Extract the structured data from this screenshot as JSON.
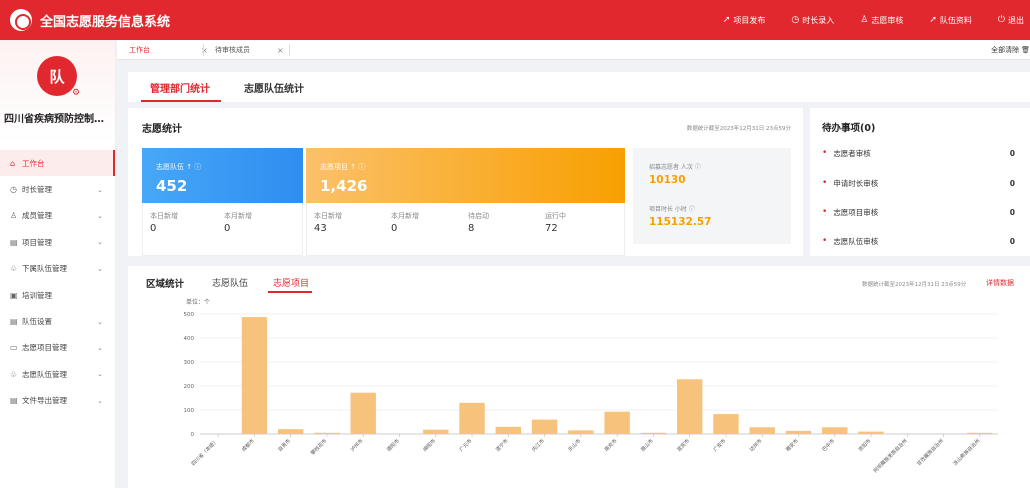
{
  "app": {
    "title": "全国志愿服务信息系统"
  },
  "top_nav": [
    {
      "icon": "send-icon",
      "glyph": "➚",
      "label": "项目发布"
    },
    {
      "icon": "clock-icon",
      "glyph": "◷",
      "label": "时长录入"
    },
    {
      "icon": "user-check-icon",
      "glyph": "♙",
      "label": "志愿审核"
    },
    {
      "icon": "send-icon",
      "glyph": "➚",
      "label": "队伍资料"
    },
    {
      "icon": "logout-icon",
      "glyph": "⏻",
      "label": "退出"
    }
  ],
  "sidebar": {
    "avatar_text": "队",
    "org_name": "四川省疾病预防控制…",
    "items": [
      {
        "icon": "home-icon",
        "glyph": "⌂",
        "label": "工作台",
        "active": true
      },
      {
        "icon": "clock-icon",
        "glyph": "◷",
        "label": "时长管理",
        "expandable": true
      },
      {
        "icon": "user-icon",
        "glyph": "♙",
        "label": "成员管理",
        "expandable": true
      },
      {
        "icon": "calendar-icon",
        "glyph": "▤",
        "label": "项目管理",
        "expandable": true
      },
      {
        "icon": "team-icon",
        "glyph": "♧",
        "label": "下属队伍管理",
        "expandable": true
      },
      {
        "icon": "training-icon",
        "glyph": "▣",
        "label": "培训管理"
      },
      {
        "icon": "settings-icon",
        "glyph": "▤",
        "label": "队伍设置",
        "expandable": true
      },
      {
        "icon": "monitor-icon",
        "glyph": "▭",
        "label": "志愿项目管理",
        "expandable": true
      },
      {
        "icon": "team-manage-icon",
        "glyph": "♧",
        "label": "志愿队伍管理",
        "expandable": true
      },
      {
        "icon": "export-icon",
        "glyph": "▤",
        "label": "文件导出管理",
        "expandable": true
      }
    ]
  },
  "tabs": {
    "workbench": "工作台",
    "pending_members": "待审核成员",
    "close_glyph": "×",
    "clear_all": "全部清除"
  },
  "subtabs": {
    "dept": "管理部门统计",
    "team": "志愿队伍统计"
  },
  "stats": {
    "title": "志愿统计",
    "updated": "数据统计截至2023年12月31日 23点59分",
    "team_card": {
      "label": "志愿队伍 ↑ ⓘ",
      "value": "452",
      "today_label": "本日新增",
      "today": "0",
      "month_label": "本月新增",
      "month": "0"
    },
    "project_card": {
      "label": "志愿项目 ↑ ⓘ",
      "value": "1,426",
      "today_label": "本日新增",
      "today": "43",
      "month_label": "本月新增",
      "month": "0",
      "pending_label": "待启动",
      "pending": "8",
      "running_label": "运行中",
      "running": "72"
    },
    "recruit": {
      "label": "招募志愿者  人次 ⓘ",
      "value": "10130"
    },
    "hours": {
      "label": "项目时长  小时 ⓘ",
      "value": "115132.57"
    }
  },
  "todo": {
    "title": "待办事项(0)",
    "items": [
      {
        "label": "志愿者审核",
        "count": "0"
      },
      {
        "label": "申请时长审核",
        "count": "0"
      },
      {
        "label": "志愿项目审核",
        "count": "0"
      },
      {
        "label": "志愿队伍审核",
        "count": "0"
      }
    ]
  },
  "region": {
    "title": "区域统计",
    "tab_team": "志愿队伍",
    "tab_project": "志愿项目",
    "updated": "数据统计截至2023年12月31日 23点59分",
    "detail_link": "详情数据"
  },
  "colors": {
    "brand": "#e0282e",
    "blue": "#3a9bf5",
    "orange": "#f8a000",
    "bar": "#f7c27c"
  },
  "chart_data": {
    "type": "bar",
    "unit": "单位：个",
    "ylim": [
      0,
      500
    ],
    "yticks": [
      0,
      100,
      200,
      300,
      400,
      500
    ],
    "categories": [
      "四川省（本级）",
      "成都市",
      "自贡市",
      "攀枝花市",
      "泸州市",
      "德阳市",
      "绵阳市",
      "广元市",
      "遂宁市",
      "内江市",
      "乐山市",
      "南充市",
      "眉山市",
      "宜宾市",
      "广安市",
      "达州市",
      "雅安市",
      "巴中市",
      "资阳市",
      "阿坝藏族羌族自治州",
      "甘孜藏族自治州",
      "凉山彝族自治州"
    ],
    "values": [
      0,
      487,
      20,
      5,
      172,
      0,
      18,
      130,
      30,
      60,
      15,
      93,
      5,
      228,
      83,
      28,
      13,
      28,
      10,
      0,
      0,
      5
    ]
  }
}
